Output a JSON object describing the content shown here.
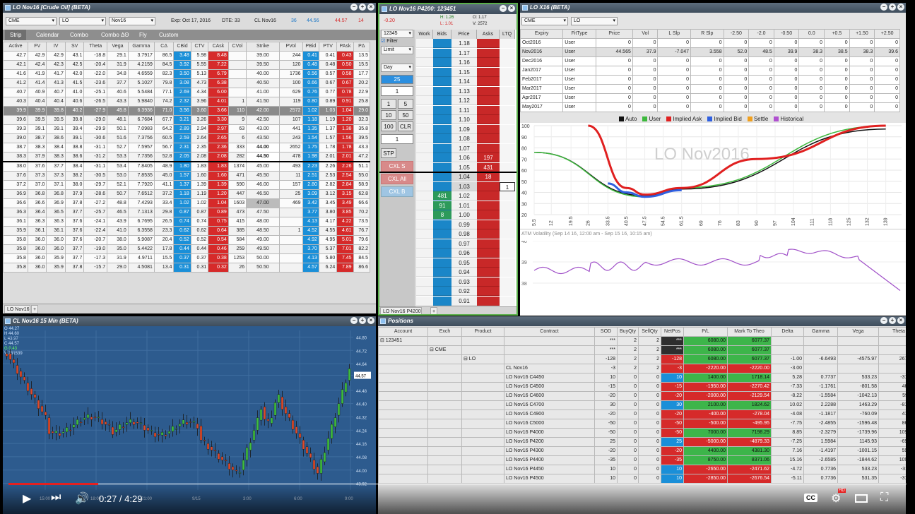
{
  "options_pane": {
    "title": "LO Nov16 [Crude Oil] (BETA)",
    "exchange": "CME",
    "product": "LO",
    "contract": "Nov16",
    "expiry": "Exp: Oct 17, 2016",
    "dte": "DTE: 33",
    "underlying": "CL Nov16",
    "ul_bid_qty": "36",
    "ul_bid": "44.56",
    "ul_ask": "44.57",
    "ul_ask_qty": "14",
    "tabs": [
      "Strip",
      "Calendar",
      "Combo",
      "Combo ΔΘ",
      "Fly",
      "Custom"
    ],
    "columns": [
      "Active",
      "FV",
      "IV",
      "SV",
      "Theta",
      "Vega",
      "Gamma",
      "CΔ",
      "CBid",
      "CTV",
      "CAsk",
      "CVol",
      "Strike",
      "PVol",
      "PBid",
      "PTV",
      "PAsk",
      "PΔ"
    ],
    "rows": [
      [
        "42.7",
        "42.9",
        "42.9",
        "43.1",
        "-18.8",
        "29.1",
        "3.7917",
        "86.5",
        "3.48",
        "5.98",
        "8.48",
        "",
        "39.00",
        "244",
        "0.41",
        "0.41",
        "0.43",
        "13.5"
      ],
      [
        "42.1",
        "42.4",
        "42.3",
        "42.5",
        "-20.4",
        "31.9",
        "4.2159",
        "84.5",
        "3.92",
        "5.55",
        "7.22",
        "",
        "39.50",
        "120",
        "0.48",
        "0.48",
        "0.50",
        "15.5"
      ],
      [
        "41.6",
        "41.9",
        "41.7",
        "42.0",
        "-22.0",
        "34.8",
        "4.6559",
        "82.3",
        "3.50",
        "5.13",
        "6.79",
        "",
        "40.00",
        "1736",
        "0.56",
        "0.57",
        "0.58",
        "17.7"
      ],
      [
        "41.2",
        "41.4",
        "41.3",
        "41.5",
        "-23.6",
        "37.7",
        "5.1027",
        "79.8",
        "3.08",
        "4.73",
        "6.38",
        "",
        "40.50",
        "100",
        "0.66",
        "0.67",
        "0.67",
        "20.2"
      ],
      [
        "40.7",
        "40.9",
        "40.7",
        "41.0",
        "-25.1",
        "40.6",
        "5.5484",
        "77.1",
        "2.69",
        "4.34",
        "6.00",
        "",
        "41.00",
        "629",
        "0.76",
        "0.77",
        "0.78",
        "22.9"
      ],
      [
        "40.3",
        "40.4",
        "40.4",
        "40.6",
        "-26.5",
        "43.3",
        "5.9840",
        "74.2",
        "2.32",
        "3.96",
        "4.01",
        "1",
        "41.50",
        "119",
        "0.80",
        "0.89",
        "0.91",
        "25.8"
      ],
      [
        "39.9",
        "39.9",
        "39.8",
        "40.2",
        "-27.9",
        "45.8",
        "6.3936",
        "71.0",
        "3.56",
        "3.60",
        "3.66",
        "110",
        "42.00",
        "2572",
        "1.02",
        "1.03",
        "1.04",
        "29.0"
      ],
      [
        "39.6",
        "39.5",
        "39.5",
        "39.8",
        "-29.0",
        "48.1",
        "6.7684",
        "67.7",
        "3.21",
        "3.26",
        "3.30",
        "9",
        "42.50",
        "107",
        "1.18",
        "1.19",
        "1.20",
        "32.3"
      ],
      [
        "39.3",
        "39.1",
        "39.1",
        "39.4",
        "-29.9",
        "50.1",
        "7.0983",
        "64.2",
        "2.89",
        "2.94",
        "2.97",
        "63",
        "43.00",
        "441",
        "1.35",
        "1.37",
        "1.38",
        "35.8"
      ],
      [
        "39.0",
        "38.7",
        "38.6",
        "39.1",
        "-30.6",
        "51.6",
        "7.3756",
        "60.5",
        "2.59",
        "2.64",
        "2.65",
        "6",
        "43.50",
        "243",
        "1.54",
        "1.57",
        "1.56",
        "39.5"
      ],
      [
        "38.7",
        "38.3",
        "38.4",
        "38.8",
        "-31.1",
        "52.7",
        "7.5957",
        "56.7",
        "2.31",
        "2.35",
        "2.36",
        "333",
        "44.00",
        "2652",
        "1.75",
        "1.78",
        "1.78",
        "43.3"
      ],
      [
        "38.3",
        "37.9",
        "38.3",
        "38.6",
        "-31.2",
        "53.3",
        "7.7356",
        "52.8",
        "2.05",
        "2.08",
        "2.08",
        "282",
        "44.50",
        "478",
        "1.98",
        "2.01",
        "2.01",
        "47.2"
      ],
      [
        "38.0",
        "37.6",
        "37.7",
        "38.4",
        "-31.1",
        "53.4",
        "7.8405",
        "48.9",
        "1.80",
        "1.83",
        "1.83",
        "1374",
        "45.00",
        "493",
        "2.23",
        "2.26",
        "2.26",
        "51.1"
      ],
      [
        "37.6",
        "37.3",
        "37.3",
        "38.2",
        "-30.5",
        "53.0",
        "7.8535",
        "45.0",
        "1.57",
        "1.60",
        "1.60",
        "471",
        "45.50",
        "11",
        "2.51",
        "2.53",
        "2.54",
        "55.0"
      ],
      [
        "37.2",
        "37.0",
        "37.1",
        "38.0",
        "-29.7",
        "52.1",
        "7.7920",
        "41.1",
        "1.37",
        "1.39",
        "1.39",
        "590",
        "46.00",
        "157",
        "2.80",
        "2.82",
        "2.84",
        "58.9"
      ],
      [
        "36.9",
        "36.8",
        "36.8",
        "37.9",
        "-28.6",
        "50.7",
        "7.6512",
        "37.2",
        "1.18",
        "1.19",
        "1.20",
        "447",
        "46.50",
        "25",
        "3.09",
        "3.12",
        "3.15",
        "62.8"
      ],
      [
        "36.6",
        "36.6",
        "36.9",
        "37.8",
        "-27.2",
        "48.8",
        "7.4293",
        "33.4",
        "1.02",
        "1.02",
        "1.04",
        "1603",
        "47.00",
        "469",
        "3.42",
        "3.45",
        "3.49",
        "66.6"
      ],
      [
        "36.3",
        "36.4",
        "36.5",
        "37.7",
        "-25.7",
        "46.5",
        "7.1313",
        "29.8",
        "0.87",
        "0.87",
        "0.89",
        "473",
        "47.50",
        "",
        "3.77",
        "3.80",
        "3.85",
        "70.2"
      ],
      [
        "36.1",
        "36.3",
        "36.3",
        "37.6",
        "-24.1",
        "43.9",
        "6.7695",
        "26.5",
        "0.74",
        "0.74",
        "0.75",
        "415",
        "48.00",
        "",
        "4.13",
        "4.17",
        "4.22",
        "73.5"
      ],
      [
        "35.9",
        "36.1",
        "36.1",
        "37.6",
        "-22.4",
        "41.0",
        "6.3558",
        "23.3",
        "0.62",
        "0.62",
        "0.64",
        "385",
        "48.50",
        "1",
        "4.52",
        "4.55",
        "4.61",
        "76.7"
      ],
      [
        "35.8",
        "36.0",
        "36.0",
        "37.6",
        "-20.7",
        "38.0",
        "5.9087",
        "20.4",
        "0.52",
        "0.52",
        "0.54",
        "584",
        "49.00",
        "",
        "4.92",
        "4.95",
        "5.01",
        "79.6"
      ],
      [
        "35.8",
        "36.0",
        "36.0",
        "37.7",
        "-19.0",
        "35.0",
        "5.4422",
        "17.8",
        "0.44",
        "0.44",
        "0.46",
        "259",
        "49.50",
        "",
        "3.70",
        "5.37",
        "7.01",
        "82.2"
      ],
      [
        "35.8",
        "36.0",
        "35.9",
        "37.7",
        "-17.3",
        "31.9",
        "4.9711",
        "15.5",
        "0.37",
        "0.37",
        "0.38",
        "1253",
        "50.00",
        "",
        "4.13",
        "5.80",
        "7.45",
        "84.5"
      ],
      [
        "35.8",
        "36.0",
        "35.9",
        "37.8",
        "-15.7",
        "29.0",
        "4.5081",
        "13.4",
        "0.31",
        "0.31",
        "0.32",
        "26",
        "50.50",
        "",
        "4.57",
        "6.24",
        "7.89",
        "86.6"
      ]
    ],
    "sheet_tab": "LO Nov16"
  },
  "ladder_pane": {
    "title": "LO Nov16 P4200: 123451",
    "pnl": "-0.20",
    "h": "H: 1.26",
    "l": "L: 1.01",
    "o": "O: 1.17",
    "v": "V: 2572",
    "account": "12345",
    "filter_label": "Filter",
    "order_type": "Limit",
    "tif": "Day",
    "qty_display": "25",
    "qty_input": "1",
    "qty_buttons": [
      "1",
      "5",
      "10",
      "50",
      "100",
      "CLR"
    ],
    "price_input": "1",
    "stp": "STP",
    "cxl_s": "CXL S",
    "cxl_all": "CXL All",
    "cxl_b": "CXL B",
    "columns": [
      "Work",
      "Bids",
      "Price",
      "Asks",
      "LTQ"
    ],
    "prices": [
      "1.18",
      "1.17",
      "1.16",
      "1.15",
      "1.14",
      "1.13",
      "1.12",
      "1.11",
      "1.10",
      "1.09",
      "1.08",
      "1.07",
      "1.06",
      "1.05",
      "1.04",
      "1.03",
      "1.02",
      "1.01",
      "1.00",
      "0.99",
      "0.98",
      "0.97",
      "0.96",
      "0.95",
      "0.94",
      "0.93",
      "0.92",
      "0.91"
    ],
    "asks": {
      "1.06": "197",
      "1.05": "431",
      "1.04": "18"
    },
    "bids": {
      "1.02": "481",
      "1.01": "91",
      "1.00": "8"
    },
    "ltq": {
      "1.03": "1"
    },
    "sheet_tab": "LO Nov16 P4200"
  },
  "vol_pane": {
    "title": "LO X16 (BETA)",
    "exchange": "CME",
    "product": "LO",
    "columns": [
      "Expiry",
      "FitType",
      "Price",
      "Vol",
      "L Slp",
      "R Slp",
      "-2.50",
      "-2.0",
      "-0.50",
      "0.0",
      "+0.5",
      "+1.50",
      "+2.50"
    ],
    "rows": [
      [
        "Oct2016",
        "User",
        "0",
        "0",
        "0",
        "0",
        "0",
        "0",
        "0",
        "0",
        "0",
        "0",
        "0"
      ],
      [
        "Nov2016",
        "User",
        "44.565",
        "37.9",
        "-7.047",
        "3.558",
        "52.0",
        "48.5",
        "39.9",
        "38.3",
        "38.5",
        "38.3",
        "39.6"
      ],
      [
        "Dec2016",
        "User",
        "0",
        "0",
        "0",
        "0",
        "0",
        "0",
        "0",
        "0",
        "0",
        "0",
        "0"
      ],
      [
        "Jan2017",
        "User",
        "0",
        "0",
        "0",
        "0",
        "0",
        "0",
        "0",
        "0",
        "0",
        "0",
        "0"
      ],
      [
        "Feb2017",
        "User",
        "0",
        "0",
        "0",
        "0",
        "0",
        "0",
        "0",
        "0",
        "0",
        "0",
        "0"
      ],
      [
        "Mar2017",
        "User",
        "0",
        "0",
        "0",
        "0",
        "0",
        "0",
        "0",
        "0",
        "0",
        "0",
        "0"
      ],
      [
        "Apr2017",
        "User",
        "0",
        "0",
        "0",
        "0",
        "0",
        "0",
        "0",
        "0",
        "0",
        "0",
        "0"
      ],
      [
        "May2017",
        "User",
        "0",
        "0",
        "0",
        "0",
        "0",
        "0",
        "0",
        "0",
        "0",
        "0",
        "0"
      ]
    ],
    "legend": [
      "Auto",
      "User",
      "Implied Ask",
      "Implied Bid",
      "Settle",
      "Historical"
    ],
    "legend_colors": [
      "#111111",
      "#3cb83c",
      "#e02020",
      "#3060e0",
      "#f0a020",
      "#b050d0"
    ],
    "watermark": "LO Nov2016",
    "yticks": [
      "100",
      "90",
      "80",
      "70",
      "60",
      "50",
      "40",
      "30",
      "20"
    ],
    "xticks": [
      "5.5",
      "12",
      "19.5",
      "26",
      "33.5",
      "40.5",
      "47.5",
      "54.5",
      "61.5",
      "69",
      "76",
      "83",
      "90",
      "97",
      "104",
      "111",
      "118",
      "125",
      "132",
      "139"
    ],
    "atm_title": "ATM Volatility (Sep 14 16, 12:00 am - Sep 15 16, 10:15 am)",
    "atm_yticks": [
      "40",
      "39",
      "38"
    ]
  },
  "chart_data": {
    "type": "line",
    "title": "LO X16 (BETA)",
    "xlabel": "",
    "ylabel": "",
    "ylim": [
      20,
      100
    ],
    "series": [
      {
        "name": "Auto",
        "x": [
          5.5,
          47.5,
          61.5,
          139
        ],
        "values": [
          76,
          37,
          43,
          97
        ]
      },
      {
        "name": "User",
        "x": [
          5.5,
          47.5,
          61.5,
          139
        ],
        "values": [
          76,
          36,
          44,
          100
        ]
      },
      {
        "name": "Implied Ask",
        "x": [
          26,
          40.5,
          47.5,
          61.5,
          90,
          139
        ],
        "values": [
          100,
          44,
          38,
          44,
          70,
          100
        ]
      },
      {
        "name": "Implied Bid",
        "x": [
          33.5,
          40.5,
          47.5,
          61.5
        ],
        "values": [
          48,
          40,
          36,
          42
        ]
      }
    ]
  },
  "cl_chart": {
    "title": "CL Nov16 15 Min (BETA)",
    "ohlc": [
      "O 44.27",
      "H 44.60",
      "L 43.97",
      "C 44.57",
      "G 0.43",
      "V 231539"
    ],
    "price_ticks": [
      "44.80",
      "44.72",
      "44.64",
      "44.57",
      "44.48",
      "44.40",
      "44.32",
      "44.24",
      "44.16",
      "44.08",
      "44.00",
      "43.92"
    ],
    "last_price": "44.57",
    "time_ticks": [
      "15:00",
      "18:00",
      "21:00",
      "9/15",
      "3:00",
      "6:00",
      "9:00"
    ]
  },
  "positions_pane": {
    "title": "Positions",
    "columns": [
      "Account",
      "Exch",
      "Product",
      "Contract",
      "SOD",
      "BuyQty",
      "SellQty",
      "NetPos",
      "P/L",
      "Mark To Theo",
      "Delta",
      "Gamma",
      "Vega",
      "Theta"
    ],
    "account_row": {
      "account": "123451",
      "sod": "***",
      "buy": "2",
      "sell": "2",
      "net": "***",
      "pl": "6080.00",
      "mtt": "6077.37"
    },
    "exch_row": {
      "exch": "CME",
      "sod": "***",
      "buy": "2",
      "sell": "2",
      "net": "***",
      "pl": "6080.00",
      "mtt": "6077.37"
    },
    "product_row": {
      "product": "LO",
      "sod": "-128",
      "buy": "2",
      "sell": "2",
      "net": "-128",
      "pl": "6080.00",
      "mtt": "6077.37",
      "delta": "-1.00",
      "gamma": "-6.6493",
      "vega": "-4575.97",
      "theta": "2675.92"
    },
    "rows": [
      {
        "contract": "CL Nov16",
        "sod": "-3",
        "buy": "2",
        "sell": "2",
        "net": "-3",
        "pl": "-2220.00",
        "mtt": "-2220.00",
        "delta": "-3.00",
        "gamma": "",
        "vega": "",
        "theta": ""
      },
      {
        "contract": "LO Nov16 C4450",
        "sod": "10",
        "buy": "0",
        "sell": "0",
        "net": "10",
        "pl": "1400.00",
        "mtt": "1718.14",
        "delta": "5.28",
        "gamma": "0.7737",
        "vega": "533.23",
        "theta": "-312.77"
      },
      {
        "contract": "LO Nov16 C4500",
        "sod": "-15",
        "buy": "0",
        "sell": "0",
        "net": "-15",
        "pl": "-1950.00",
        "mtt": "-2270.42",
        "delta": "-7.33",
        "gamma": "-1.1761",
        "vega": "-801.58",
        "theta": "465.75"
      },
      {
        "contract": "LO Nov16 C4600",
        "sod": "-20",
        "buy": "0",
        "sell": "0",
        "net": "-20",
        "pl": "-2000.00",
        "mtt": "-2129.54",
        "delta": "-8.22",
        "gamma": "-1.5584",
        "vega": "-1042.13",
        "theta": "593.11"
      },
      {
        "contract": "LO Nov16 C4700",
        "sod": "30",
        "buy": "0",
        "sell": "0",
        "net": "30",
        "pl": "2100.00",
        "mtt": "1824.62",
        "delta": "10.02",
        "gamma": "2.2288",
        "vega": "1463.29",
        "theta": "-816.49"
      },
      {
        "contract": "LO Nov16 C4900",
        "sod": "-20",
        "buy": "0",
        "sell": "0",
        "net": "-20",
        "pl": "-400.00",
        "mtt": "-278.04",
        "delta": "-4.08",
        "gamma": "-1.1817",
        "vega": "-760.09",
        "theta": "413.72"
      },
      {
        "contract": "LO Nov16 C5000",
        "sod": "-50",
        "buy": "0",
        "sell": "0",
        "net": "-50",
        "pl": "-500.00",
        "mtt": "-495.95",
        "delta": "-7.75",
        "gamma": "-2.4855",
        "vega": "-1596.48",
        "theta": "865.17"
      },
      {
        "contract": "LO Nov16 P4000",
        "sod": "-50",
        "buy": "0",
        "sell": "0",
        "net": "-50",
        "pl": "7000.00",
        "mtt": "7198.29",
        "delta": "8.85",
        "gamma": "-2.3279",
        "vega": "-1739.96",
        "theta": "1098.54"
      },
      {
        "contract": "LO Nov16 P4200",
        "sod": "25",
        "buy": "0",
        "sell": "0",
        "net": "25",
        "pl": "-5000.00",
        "mtt": "-4879.33",
        "delta": "-7.25",
        "gamma": "1.5984",
        "vega": "1145.93",
        "theta": "-696.20"
      },
      {
        "contract": "LO Nov16 P4300",
        "sod": "-20",
        "buy": "0",
        "sell": "0",
        "net": "-20",
        "pl": "4400.00",
        "mtt": "4381.30",
        "delta": "7.16",
        "gamma": "-1.4197",
        "vega": "-1001.15",
        "theta": "598.96"
      },
      {
        "contract": "LO Nov16 P4400",
        "sod": "-35",
        "buy": "0",
        "sell": "0",
        "net": "-35",
        "pl": "8750.00",
        "mtt": "8371.06",
        "delta": "15.16",
        "gamma": "-2.6585",
        "vega": "-1844.62",
        "theta": "1096.98"
      },
      {
        "contract": "LO Nov16 P4450",
        "sod": "10",
        "buy": "0",
        "sell": "0",
        "net": "10",
        "pl": "-2650.00",
        "mtt": "-2471.62",
        "delta": "-4.72",
        "gamma": "0.7736",
        "vega": "533.23",
        "theta": "-311.77"
      },
      {
        "contract": "LO Nov16 P4500",
        "sod": "10",
        "buy": "0",
        "sell": "0",
        "net": "10",
        "pl": "-2850.00",
        "mtt": "-2676.54",
        "delta": "-5.11",
        "gamma": "0.7736",
        "vega": "531.35",
        "theta": "-310.77"
      }
    ]
  },
  "video": {
    "time": "0:27 / 4:29",
    "progress": 0.1,
    "cc": "CC",
    "hd": "HD"
  }
}
